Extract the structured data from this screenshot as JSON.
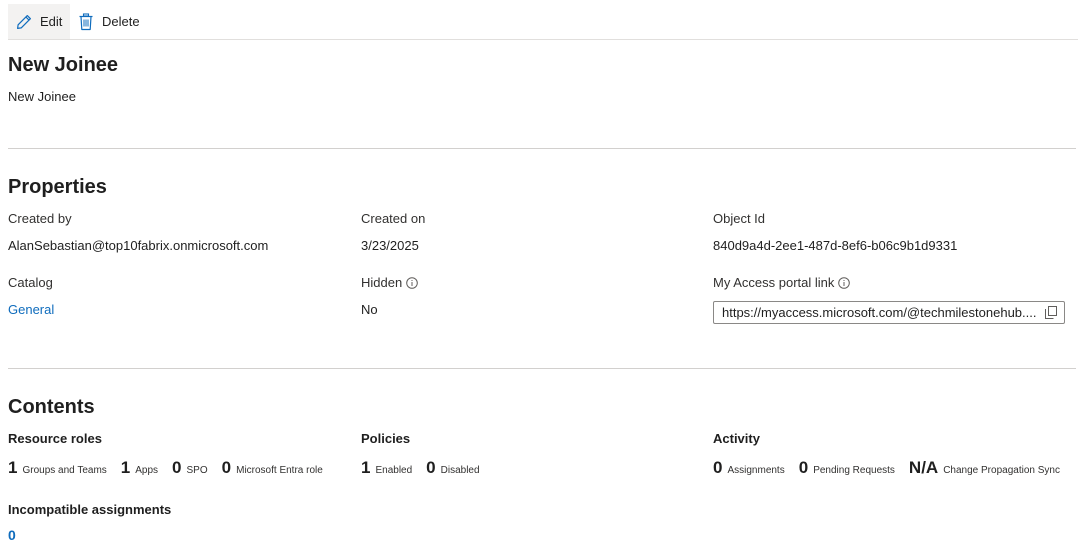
{
  "toolbar": {
    "edit_label": "Edit",
    "delete_label": "Delete"
  },
  "header": {
    "title": "New Joinee",
    "description": "New Joinee"
  },
  "properties": {
    "heading": "Properties",
    "created_by_label": "Created by",
    "created_by_value": "AlanSebastian@top10fabrix.onmicrosoft.com",
    "created_on_label": "Created on",
    "created_on_value": "3/23/2025",
    "object_id_label": "Object Id",
    "object_id_value": "840d9a4d-2ee1-487d-8ef6-b06c9b1d9331",
    "catalog_label": "Catalog",
    "catalog_value": "General",
    "hidden_label": "Hidden",
    "hidden_value": "No",
    "portal_link_label": "My Access portal link",
    "portal_link_value": "https://myaccess.microsoft.com/@techmilestonehub...."
  },
  "contents": {
    "heading": "Contents",
    "resource_roles": {
      "heading": "Resource roles",
      "stats": [
        {
          "num": "1",
          "cap": "Groups and Teams"
        },
        {
          "num": "1",
          "cap": "Apps"
        },
        {
          "num": "0",
          "cap": "SPO"
        },
        {
          "num": "0",
          "cap": "Microsoft Entra role"
        }
      ]
    },
    "policies": {
      "heading": "Policies",
      "stats": [
        {
          "num": "1",
          "cap": "Enabled"
        },
        {
          "num": "0",
          "cap": "Disabled"
        }
      ]
    },
    "activity": {
      "heading": "Activity",
      "stats": [
        {
          "num": "0",
          "cap": "Assignments"
        },
        {
          "num": "0",
          "cap": "Pending Requests"
        },
        {
          "num": "N/A",
          "cap": "Change Propagation Sync"
        }
      ]
    },
    "incompatible": {
      "heading": "Incompatible assignments",
      "value": "0"
    }
  },
  "icons": {
    "edit": "pencil-icon",
    "delete": "trash-icon",
    "info": "info-icon",
    "copy": "copy-icon"
  },
  "colors": {
    "link": "#0f6cbd",
    "accent": "#0f6cbd"
  }
}
